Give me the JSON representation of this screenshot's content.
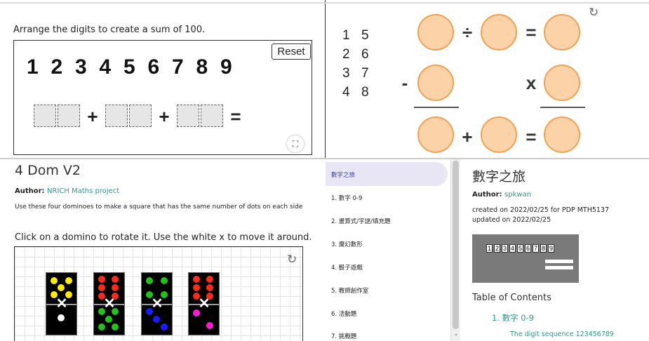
{
  "p1": {
    "prompt": "Arrange the digits to create a sum of 100.",
    "reset_label": "Reset",
    "digits": [
      "1",
      "2",
      "3",
      "4",
      "5",
      "6",
      "7",
      "8",
      "9"
    ],
    "plus": "+",
    "equals": "=",
    "expand_icon": "fullscreen-icon"
  },
  "p2": {
    "col1": [
      "1",
      "2",
      "3",
      "4"
    ],
    "col2": [
      "5",
      "6",
      "7",
      "8"
    ],
    "divide": "÷",
    "equals": "=",
    "minus": "-",
    "times": "x",
    "plus": "+",
    "circle_fill": "#fcd2a8",
    "circle_stroke": "#f2a052"
  },
  "p3": {
    "title": "4 Dom V2",
    "author_label": "Author:",
    "author": "NRICH Maths project",
    "description": "Use these four dominoes to make a square that has the same number of dots on each side",
    "instruction": "Click on a domino to rotate it. Use the white x to move it around.",
    "move_mark": "✕"
  },
  "sidebar": {
    "items": [
      "數字之旅",
      "1. 數字 0-9",
      "2. 畫算式/字謎/填充題",
      "3. 魔幻數形",
      "4. 骰子遊戲",
      "5. 教師創作室",
      "6. 活動題",
      "7. 挑戰題"
    ],
    "active_color": "#e8e6f5"
  },
  "p5": {
    "title": "數字之旅",
    "author_label": "Author:",
    "author": "spkwan",
    "created": "created on 2022/02/25 for PDP MTH5137",
    "updated": "updated on 2022/02/25",
    "thumb_digits": [
      "1",
      "2",
      "3",
      "4",
      "5",
      "6",
      "7",
      "8",
      "9"
    ],
    "toc_heading": "Table of Contents",
    "toc_item1": "1. 數字 0-9",
    "toc_sub1": "The digit sequence 123456789"
  }
}
